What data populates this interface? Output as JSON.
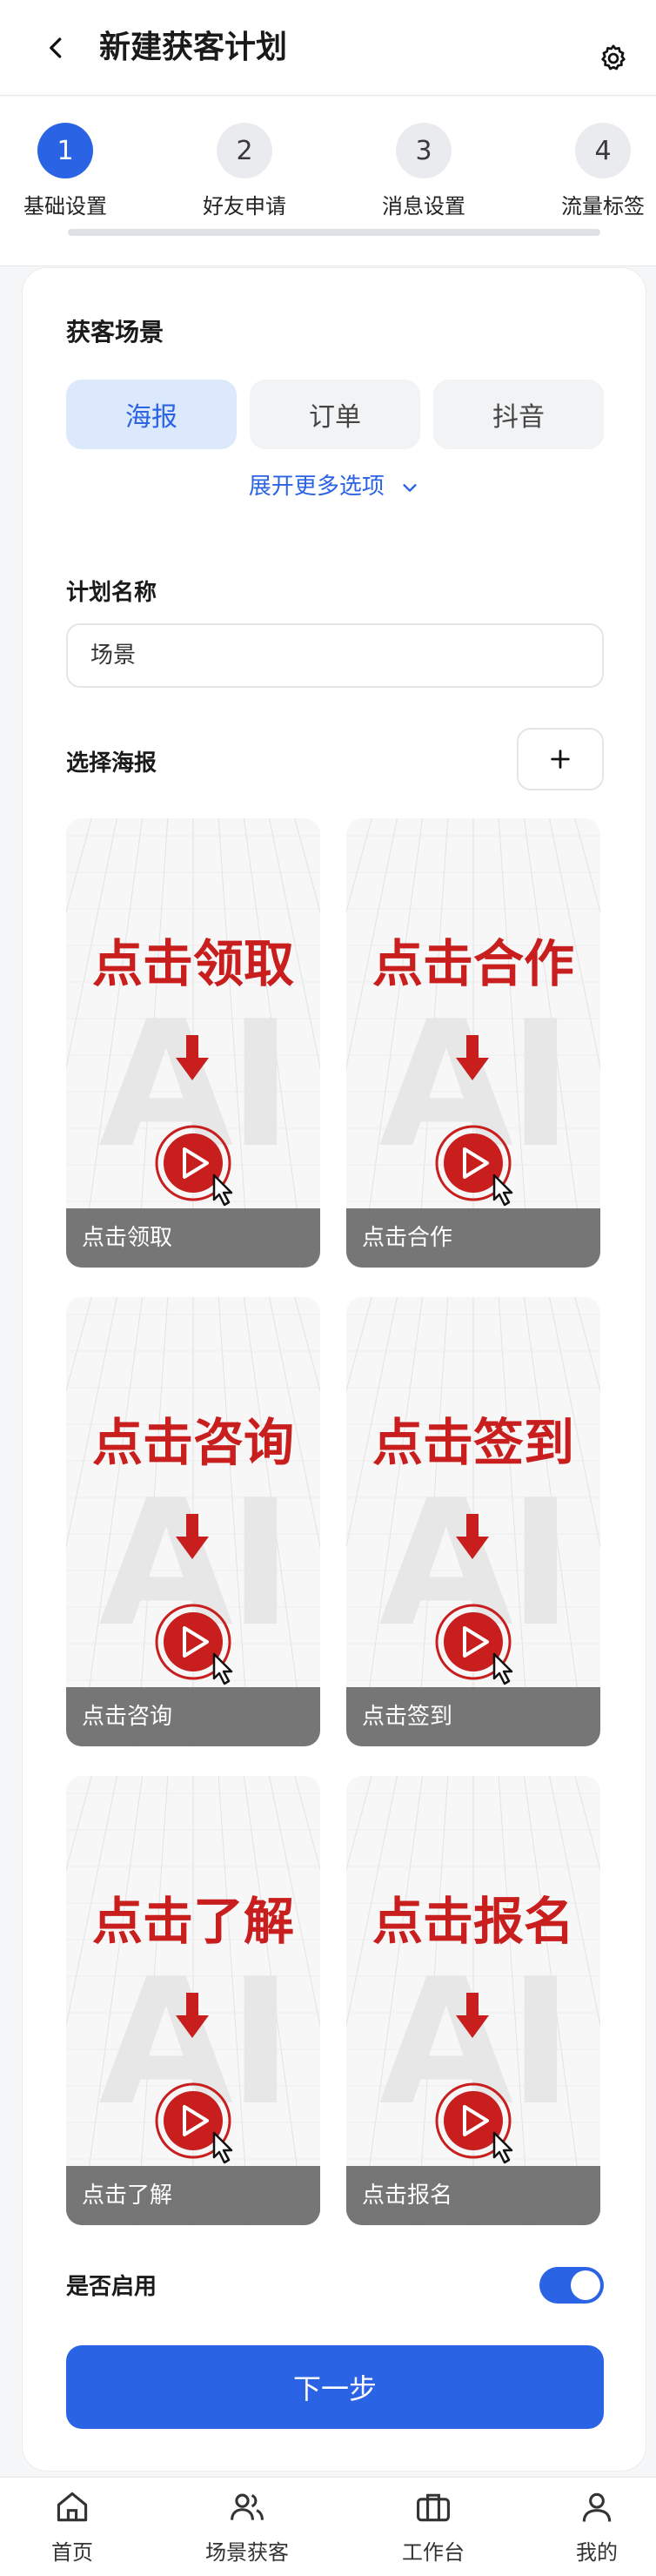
{
  "header": {
    "title": "新建获客计划"
  },
  "steps": [
    {
      "number": "1",
      "label": "基础设置"
    },
    {
      "number": "2",
      "label": "好友申请"
    },
    {
      "number": "3",
      "label": "消息设置"
    },
    {
      "number": "4",
      "label": "流量标签"
    }
  ],
  "scene": {
    "title": "获客场景",
    "options": [
      "海报",
      "订单",
      "抖音"
    ],
    "expand_label": "展开更多选项"
  },
  "plan": {
    "title": "计划名称",
    "value": "场景"
  },
  "poster_section": {
    "title": "选择海报",
    "add_label": "+"
  },
  "posters": [
    {
      "headline": "点击领取",
      "caption": "点击领取"
    },
    {
      "headline": "点击合作",
      "caption": "点击合作"
    },
    {
      "headline": "点击咨询",
      "caption": "点击咨询"
    },
    {
      "headline": "点击签到",
      "caption": "点击签到"
    },
    {
      "headline": "点击了解",
      "caption": "点击了解"
    },
    {
      "headline": "点击报名",
      "caption": "点击报名"
    }
  ],
  "poster_watermark": "AI",
  "enable": {
    "label": "是否启用",
    "on": true
  },
  "next_label": "下一步",
  "tabs": [
    {
      "label": "首页",
      "icon": "home-icon"
    },
    {
      "label": "场景获客",
      "icon": "users-icon"
    },
    {
      "label": "工作台",
      "icon": "briefcase-icon"
    },
    {
      "label": "我的",
      "icon": "user-icon"
    }
  ],
  "colors": {
    "accent": "#2b63e5",
    "poster_red": "#c81e1e"
  }
}
